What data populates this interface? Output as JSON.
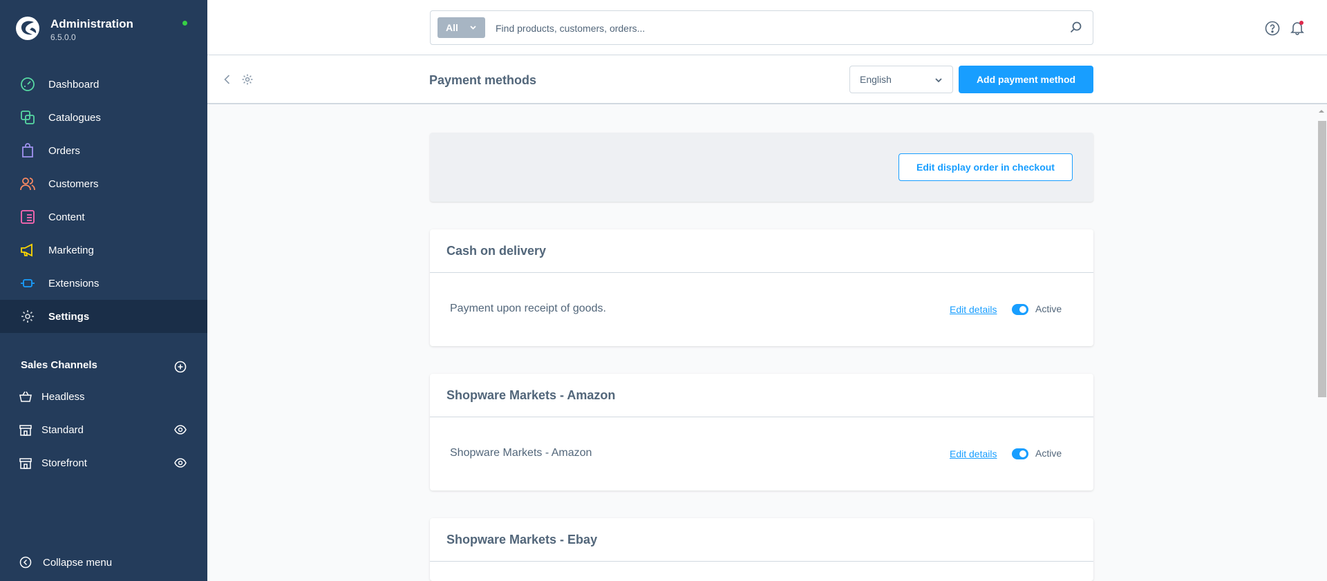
{
  "brand": {
    "title": "Administration",
    "version": "6.5.0.0",
    "status_color": "#37d046"
  },
  "nav": {
    "items": [
      {
        "label": "Dashboard",
        "icon": "dashboard-icon",
        "color": "#57d9a3"
      },
      {
        "label": "Catalogues",
        "icon": "catalogue-icon",
        "color": "#57d9a3"
      },
      {
        "label": "Orders",
        "icon": "bag-icon",
        "color": "#a092f0"
      },
      {
        "label": "Customers",
        "icon": "users-icon",
        "color": "#f88962"
      },
      {
        "label": "Content",
        "icon": "content-icon",
        "color": "#ff68b4"
      },
      {
        "label": "Marketing",
        "icon": "megaphone-icon",
        "color": "#ffd700"
      },
      {
        "label": "Extensions",
        "icon": "plug-icon",
        "color": "#189eff"
      },
      {
        "label": "Settings",
        "icon": "gear-icon",
        "color": "#c4cbd3",
        "active": true
      }
    ]
  },
  "sales_channels": {
    "title": "Sales Channels",
    "items": [
      {
        "label": "Headless",
        "icon": "basket-icon"
      },
      {
        "label": "Standard",
        "icon": "storefront-icon",
        "eye": true
      },
      {
        "label": "Storefront",
        "icon": "storefront-icon",
        "eye": true
      }
    ]
  },
  "collapse_label": "Collapse menu",
  "search": {
    "type_label": "All",
    "placeholder": "Find products, customers, orders..."
  },
  "smartbar": {
    "title": "Payment methods",
    "language": "English",
    "add_button": "Add payment method"
  },
  "toolbar": {
    "edit_order_button": "Edit display order in checkout"
  },
  "payment_methods": [
    {
      "name": "Cash on delivery",
      "description": "Payment upon receipt of goods.",
      "edit_label": "Edit details",
      "status": "Active"
    },
    {
      "name": "Shopware Markets - Amazon",
      "description": "Shopware Markets - Amazon",
      "edit_label": "Edit details",
      "status": "Active"
    },
    {
      "name": "Shopware Markets - Ebay"
    }
  ],
  "colors": {
    "sidebar": "#243c5b",
    "sidebar_active": "#1a2e48",
    "accent": "#189eff"
  }
}
